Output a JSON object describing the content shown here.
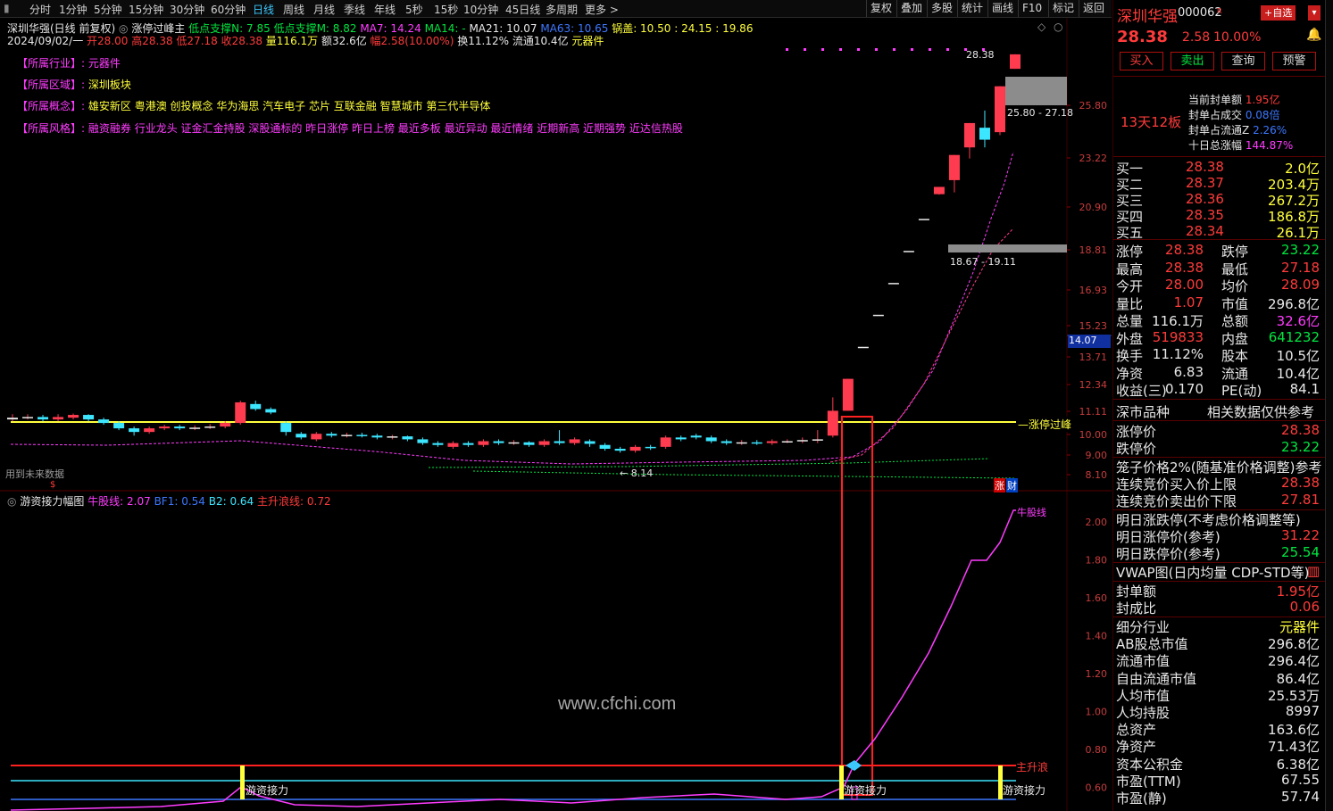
{
  "toolbar": {
    "period_tabs": [
      "分时",
      "1分钟",
      "5分钟",
      "15分钟",
      "30分钟",
      "60分钟",
      "日线",
      "周线",
      "月线",
      "季线",
      "年线",
      "5秒",
      "15秒",
      "10分钟",
      "45日线",
      "多周期",
      "更多 >"
    ],
    "active_tab": "日线",
    "right_buttons": [
      "复权",
      "叠加",
      "多股",
      "统计",
      "画线",
      "F10",
      "标记",
      "返回"
    ]
  },
  "main_chart": {
    "title": "深圳华强(日线 前复权)",
    "indicator_name": "涨停过峰主",
    "legend": [
      {
        "label": "低点支撑N: 7.85",
        "color": "#00e640"
      },
      {
        "label": "低点支撑M: 8.82",
        "color": "#00e640"
      },
      {
        "label": "MA7: 14.24",
        "color": "#ff3cff"
      },
      {
        "label": "MA14: -",
        "color": "#00e640"
      },
      {
        "label": "MA21: 10.07",
        "color": "#e8e8e8"
      },
      {
        "label": "MA63: 10.65",
        "color": "#3c78ff"
      },
      {
        "label": "锅盖: 10.50 : 24.15 : 19.86",
        "color": "#ffff3c"
      }
    ],
    "ohlc_line": {
      "date": "2024/09/02/一",
      "open": "开28.00",
      "high": "高28.38",
      "low": "低27.18",
      "close": "收28.38",
      "volume": "量116.1万",
      "amount": "额32.6亿",
      "change": "幅2.58(10.00%)",
      "turnover": "换11.12%",
      "float": "流通10.4亿",
      "sector": "元器件"
    },
    "concepts": [
      {
        "label": "【所属行业】:",
        "value": "元器件"
      },
      {
        "label": "【所属区域】:",
        "value": "深圳板块"
      },
      {
        "label": "【所属概念】:",
        "value": "雄安新区 粤港澳 创投概念 华为海思 汽车电子 芯片 互联金融 智慧城市 第三代半导体"
      },
      {
        "label": "【所属风格】:",
        "value": "融资融券 行业龙头 证金汇金持股 深股通标的 昨日涨停 昨日上榜 最近多板 最近异动 最近情绪 近期新高 近期强势 近达信热股"
      }
    ],
    "y_ticks": [
      "25.80",
      "23.22",
      "20.90",
      "18.81",
      "16.93",
      "15.23",
      "13.71",
      "12.34",
      "11.11",
      "10.00",
      "9.00",
      "8.10"
    ],
    "current_price_tag": "14.07",
    "high_label": "28.38",
    "low_label": "8.14",
    "zone_upper_label": "25.80 - 27.18",
    "zone_lower_label": "18.67 - 19.11",
    "limit_line_label": "涨停过峰",
    "future_data_note": "用到未来数据",
    "bottom_tags": [
      "涨",
      "财"
    ],
    "watermark": "www.cfchi.com"
  },
  "sub_chart": {
    "title": "游资接力幅图",
    "legend": [
      {
        "label": "牛股线: 2.07",
        "color": "#ff3cff"
      },
      {
        "label": "BF1: 0.54",
        "color": "#3c78ff"
      },
      {
        "label": "B2: 0.64",
        "color": "#3ce6ff"
      },
      {
        "label": "主升浪线: 0.72",
        "color": "#ff3b3b"
      }
    ],
    "y_ticks": [
      "2.00",
      "1.80",
      "1.60",
      "1.40",
      "1.20",
      "1.00",
      "0.80",
      "0.60"
    ],
    "main_wave_label": "主升浪",
    "bull_label": "牛股线",
    "relay_label": "游资接力",
    "signal_marks": [
      "游资接力",
      "游资接力",
      "游资接力"
    ]
  },
  "quote_panel": {
    "name": "深圳华强",
    "code": "000062",
    "code_tag": "R",
    "add_watch": "+自选",
    "price": "28.38",
    "change": "2.58",
    "change_pct": "10.00%",
    "buttons": [
      "买入",
      "卖出",
      "查询",
      "预警"
    ],
    "board_label": "13天12板",
    "seal_stats": [
      {
        "label": "当前封单额",
        "value": "1.95亿"
      },
      {
        "label": "封单占成交",
        "value": "0.08倍"
      },
      {
        "label": "封单占流通Z",
        "value": "2.26%"
      },
      {
        "label": "十日总涨幅",
        "value": "144.87%"
      }
    ],
    "bids": [
      {
        "label": "买一",
        "price": "28.38",
        "vol": "2.0亿"
      },
      {
        "label": "买二",
        "price": "28.37",
        "vol": "203.4万"
      },
      {
        "label": "买三",
        "price": "28.36",
        "vol": "267.2万"
      },
      {
        "label": "买四",
        "price": "28.35",
        "vol": "186.8万"
      },
      {
        "label": "买五",
        "price": "28.34",
        "vol": "26.1万"
      }
    ],
    "stats": [
      {
        "l1": "涨停",
        "v1": "28.38",
        "c1": "#ff3b3b",
        "l2": "跌停",
        "v2": "23.22",
        "c2": "#00e640"
      },
      {
        "l1": "最高",
        "v1": "28.38",
        "c1": "#ff3b3b",
        "l2": "最低",
        "v2": "27.18",
        "c2": "#ff3b3b"
      },
      {
        "l1": "今开",
        "v1": "28.00",
        "c1": "#ff3b3b",
        "l2": "均价",
        "v2": "28.09",
        "c2": "#ff3b3b"
      },
      {
        "l1": "量比",
        "v1": "1.07",
        "c1": "#ff3b3b",
        "l2": "市值",
        "v2": "296.8亿",
        "c2": "#e8e8e8"
      },
      {
        "l1": "总量",
        "v1": "116.1万",
        "c1": "#e8e8e8",
        "l2": "总额",
        "v2": "32.6亿",
        "c2": "#ff3cff"
      },
      {
        "l1": "外盘",
        "v1": "519833",
        "c1": "#ff3b3b",
        "l2": "内盘",
        "v2": "641232",
        "c2": "#00e640"
      },
      {
        "l1": "换手",
        "v1": "11.12%",
        "c1": "#e8e8e8",
        "l2": "股本",
        "v2": "10.5亿",
        "c2": "#e8e8e8"
      },
      {
        "l1": "净资",
        "v1": "6.83",
        "c1": "#e8e8e8",
        "l2": "流通",
        "v2": "10.4亿",
        "c2": "#e8e8e8"
      },
      {
        "l1": "收益(三)",
        "v1": "0.170",
        "c1": "#e8e8e8",
        "l2": "PE(动)",
        "v2": "84.1",
        "c2": "#e8e8e8"
      }
    ],
    "section_market": {
      "left": "深市品种",
      "right": "相关数据仅供参考"
    },
    "limits": [
      {
        "label": "涨停价",
        "value": "28.38",
        "color": "#ff3b3b"
      },
      {
        "label": "跌停价",
        "value": "23.22",
        "color": "#00e640"
      }
    ],
    "cage_title": "笼子价格2%(随基准价格调整)参考",
    "cage": [
      {
        "label": "连续竞价买入价上限",
        "value": "28.38",
        "color": "#ff3b3b"
      },
      {
        "label": "连续竞价卖出价下限",
        "value": "27.81",
        "color": "#ff3b3b"
      }
    ],
    "tomorrow_title": "明日涨跌停(不考虑价格调整等)",
    "tomorrow": [
      {
        "label": "明日涨停价(参考)",
        "value": "31.22",
        "color": "#ff3b3b"
      },
      {
        "label": "明日跌停价(参考)",
        "value": "25.54",
        "color": "#00e640"
      }
    ],
    "vwap_title": "VWAP图(日内均量 CDP-STD等)",
    "seal": [
      {
        "label": "封单额",
        "value": "1.95亿",
        "color": "#ff3b3b"
      },
      {
        "label": "封成比",
        "value": "0.06",
        "color": "#ff3b3b"
      }
    ],
    "finance": [
      {
        "label": "细分行业",
        "value": "元器件",
        "color": "#ffff3c"
      },
      {
        "label": "AB股总市值",
        "value": "296.8亿",
        "color": "#e8e8e8"
      },
      {
        "label": "流通市值",
        "value": "296.4亿",
        "color": "#e8e8e8"
      },
      {
        "label": "自由流通市值",
        "value": "86.4亿",
        "color": "#e8e8e8"
      },
      {
        "label": "人均市值",
        "value": "25.53万",
        "color": "#e8e8e8"
      },
      {
        "label": "人均持股",
        "value": "8997",
        "color": "#e8e8e8"
      },
      {
        "label": "总资产",
        "value": "163.6亿",
        "color": "#e8e8e8"
      },
      {
        "label": "净资产",
        "value": "71.43亿",
        "color": "#e8e8e8"
      },
      {
        "label": "资本公积金",
        "value": "6.38亿",
        "color": "#e8e8e8"
      },
      {
        "label": "市盈(TTM)",
        "value": "67.55",
        "color": "#e8e8e8"
      },
      {
        "label": "市盈(静)",
        "value": "57.74",
        "color": "#e8e8e8"
      }
    ]
  },
  "chart_data": {
    "type": "candlestick",
    "note": "Daily K-line of 深圳华强; approximate closes read from axis",
    "candles": [
      {
        "o": 9.55,
        "c": 9.6,
        "h": 9.7,
        "l": 9.5
      },
      {
        "o": 9.6,
        "c": 9.62,
        "h": 9.7,
        "l": 9.55
      },
      {
        "o": 9.62,
        "c": 9.55,
        "h": 9.68,
        "l": 9.5
      },
      {
        "o": 9.55,
        "c": 9.62,
        "h": 9.7,
        "l": 9.5
      },
      {
        "o": 9.6,
        "c": 9.68,
        "h": 9.72,
        "l": 9.55
      },
      {
        "o": 9.68,
        "c": 9.55,
        "h": 9.7,
        "l": 9.5
      },
      {
        "o": 9.55,
        "c": 9.45,
        "h": 9.6,
        "l": 9.4
      },
      {
        "o": 9.45,
        "c": 9.3,
        "h": 9.5,
        "l": 9.25
      },
      {
        "o": 9.3,
        "c": 9.2,
        "h": 9.35,
        "l": 9.1
      },
      {
        "o": 9.2,
        "c": 9.3,
        "h": 9.35,
        "l": 9.15
      },
      {
        "o": 9.3,
        "c": 9.35,
        "h": 9.4,
        "l": 9.25
      },
      {
        "o": 9.35,
        "c": 9.3,
        "h": 9.4,
        "l": 9.25
      },
      {
        "o": 9.3,
        "c": 9.32,
        "h": 9.38,
        "l": 9.25
      },
      {
        "o": 9.32,
        "c": 9.35,
        "h": 9.42,
        "l": 9.28
      },
      {
        "o": 9.35,
        "c": 9.45,
        "h": 9.5,
        "l": 9.3
      },
      {
        "o": 9.45,
        "c": 10.05,
        "h": 10.1,
        "l": 9.4
      },
      {
        "o": 10.0,
        "c": 9.85,
        "h": 10.1,
        "l": 9.8
      },
      {
        "o": 9.85,
        "c": 9.75,
        "h": 9.9,
        "l": 9.7
      },
      {
        "o": 9.45,
        "c": 9.2,
        "h": 9.5,
        "l": 9.1
      },
      {
        "o": 9.15,
        "c": 9.05,
        "h": 9.2,
        "l": 9.0
      },
      {
        "o": 9.0,
        "c": 9.15,
        "h": 9.2,
        "l": 8.95
      },
      {
        "o": 9.15,
        "c": 9.1,
        "h": 9.2,
        "l": 9.05
      },
      {
        "o": 9.1,
        "c": 9.12,
        "h": 9.18,
        "l": 9.05
      },
      {
        "o": 9.12,
        "c": 9.1,
        "h": 9.18,
        "l": 9.05
      },
      {
        "o": 9.1,
        "c": 9.05,
        "h": 9.15,
        "l": 9.0
      },
      {
        "o": 9.05,
        "c": 9.08,
        "h": 9.12,
        "l": 9.0
      },
      {
        "o": 9.08,
        "c": 9.0,
        "h": 9.1,
        "l": 8.95
      },
      {
        "o": 9.0,
        "c": 8.9,
        "h": 9.05,
        "l": 8.85
      },
      {
        "o": 8.9,
        "c": 8.85,
        "h": 8.95,
        "l": 8.8
      },
      {
        "o": 8.8,
        "c": 8.9,
        "h": 8.95,
        "l": 8.75
      },
      {
        "o": 8.9,
        "c": 8.85,
        "h": 8.95,
        "l": 8.8
      },
      {
        "o": 8.85,
        "c": 8.95,
        "h": 9.0,
        "l": 8.8
      },
      {
        "o": 8.95,
        "c": 8.9,
        "h": 9.0,
        "l": 8.85
      },
      {
        "o": 8.9,
        "c": 8.92,
        "h": 8.98,
        "l": 8.85
      },
      {
        "o": 8.92,
        "c": 8.85,
        "h": 8.95,
        "l": 8.8
      },
      {
        "o": 8.85,
        "c": 8.95,
        "h": 9.0,
        "l": 8.8
      },
      {
        "o": 8.95,
        "c": 8.9,
        "h": 9.25,
        "l": 8.85
      },
      {
        "o": 8.9,
        "c": 9.0,
        "h": 9.05,
        "l": 8.85
      },
      {
        "o": 8.95,
        "c": 8.88,
        "h": 9.0,
        "l": 8.8
      },
      {
        "o": 8.85,
        "c": 8.75,
        "h": 8.9,
        "l": 8.7
      },
      {
        "o": 8.75,
        "c": 8.7,
        "h": 8.8,
        "l": 8.65
      },
      {
        "o": 8.7,
        "c": 8.8,
        "h": 8.85,
        "l": 8.65
      },
      {
        "o": 8.8,
        "c": 8.78,
        "h": 8.85,
        "l": 8.72
      },
      {
        "o": 8.8,
        "c": 9.05,
        "h": 9.1,
        "l": 8.75
      },
      {
        "o": 9.05,
        "c": 9.0,
        "h": 9.1,
        "l": 8.95
      },
      {
        "o": 9.1,
        "c": 9.05,
        "h": 9.15,
        "l": 9.0
      },
      {
        "o": 9.05,
        "c": 8.95,
        "h": 9.1,
        "l": 8.9
      },
      {
        "o": 8.95,
        "c": 8.9,
        "h": 9.0,
        "l": 8.85
      },
      {
        "o": 8.9,
        "c": 8.92,
        "h": 8.98,
        "l": 8.85
      },
      {
        "o": 8.92,
        "c": 8.9,
        "h": 8.98,
        "l": 8.85
      },
      {
        "o": 8.9,
        "c": 8.95,
        "h": 9.0,
        "l": 8.85
      },
      {
        "o": 8.95,
        "c": 8.95,
        "h": 9.0,
        "l": 8.9
      },
      {
        "o": 8.95,
        "c": 8.98,
        "h": 9.05,
        "l": 8.9
      },
      {
        "o": 8.98,
        "c": 9.0,
        "h": 9.25,
        "l": 8.9
      },
      {
        "o": 9.1,
        "c": 9.8,
        "h": 10.2,
        "l": 9.05
      },
      {
        "o": 9.8,
        "c": 10.78,
        "h": 10.78,
        "l": 9.8
      },
      {
        "o": 11.86,
        "c": 11.86,
        "h": 11.86,
        "l": 11.86
      },
      {
        "o": 13.05,
        "c": 13.05,
        "h": 13.05,
        "l": 13.05
      },
      {
        "o": 14.35,
        "c": 14.35,
        "h": 14.35,
        "l": 14.35
      },
      {
        "o": 15.79,
        "c": 15.79,
        "h": 15.79,
        "l": 15.79
      },
      {
        "o": 17.37,
        "c": 17.37,
        "h": 17.37,
        "l": 17.37
      },
      {
        "o": 18.7,
        "c": 19.11,
        "h": 19.11,
        "l": 18.67
      },
      {
        "o": 19.5,
        "c": 21.02,
        "h": 21.02,
        "l": 18.8
      },
      {
        "o": 21.5,
        "c": 23.12,
        "h": 23.12,
        "l": 20.8
      },
      {
        "o": 22.8,
        "c": 22.0,
        "h": 24.0,
        "l": 21.5
      },
      {
        "o": 22.5,
        "c": 25.8,
        "h": 25.8,
        "l": 22.3
      },
      {
        "o": 27.18,
        "c": 28.38,
        "h": 28.38,
        "l": 27.18
      }
    ],
    "ylim": [
      8.0,
      28.5
    ],
    "y_scale": "log"
  }
}
